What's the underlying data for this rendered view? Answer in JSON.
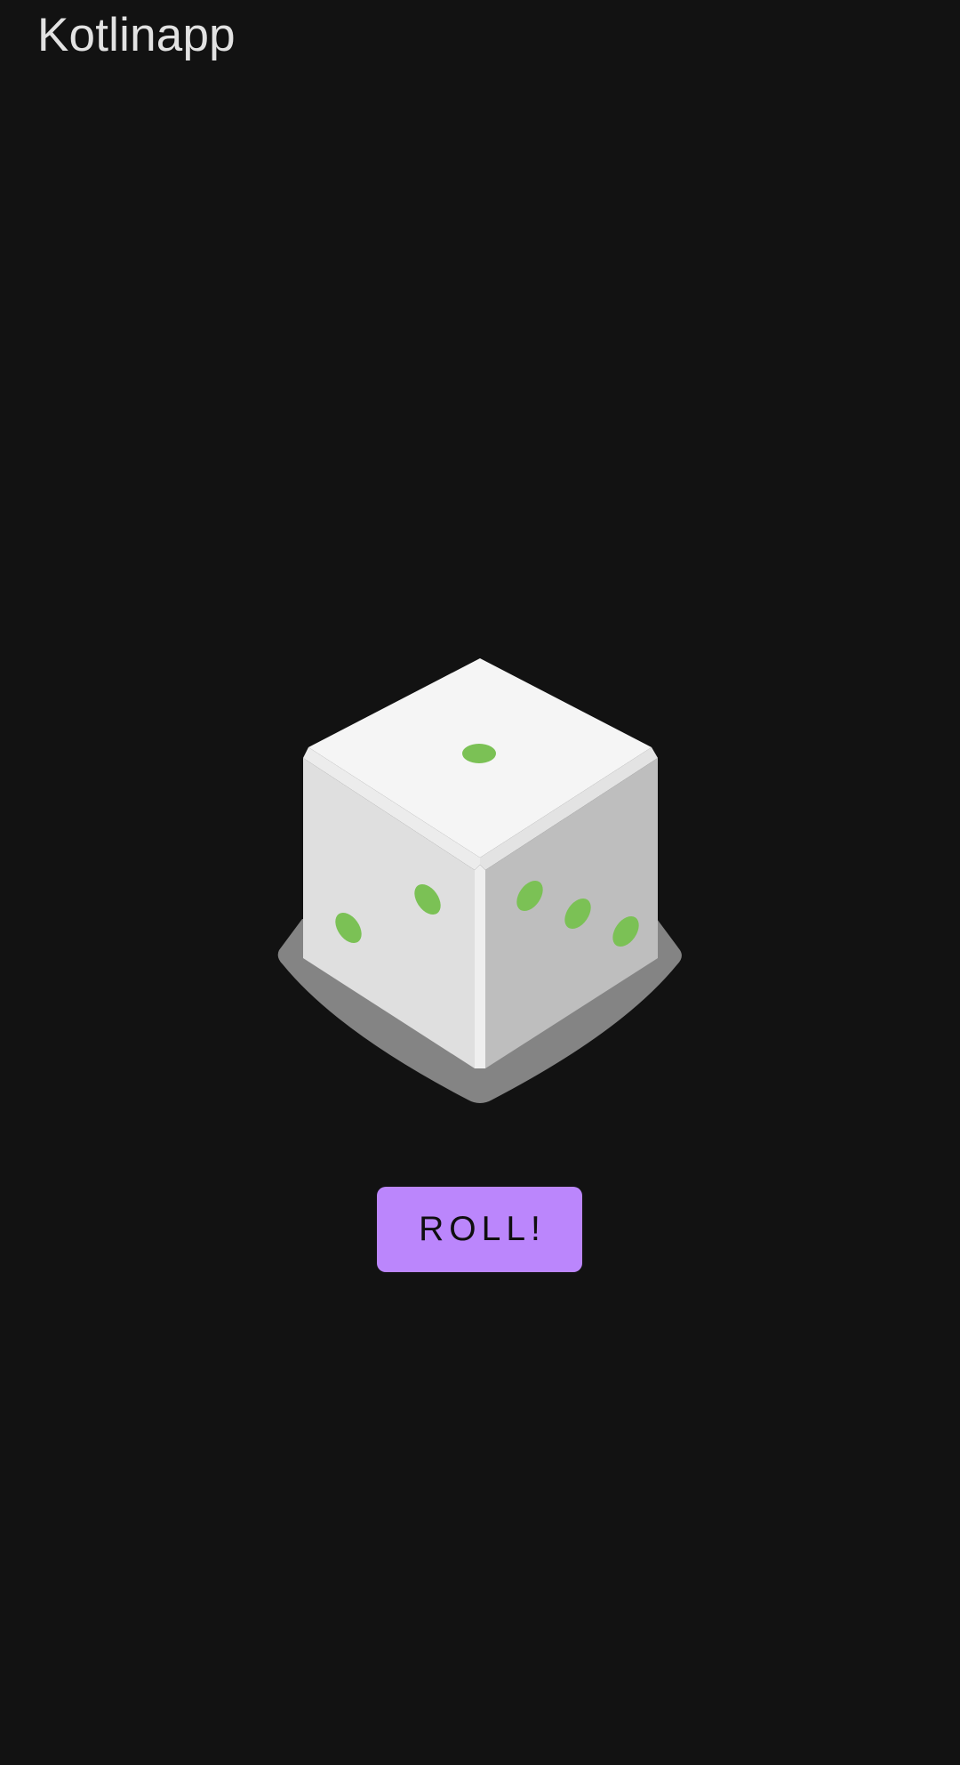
{
  "app": {
    "title": "Kotlinapp"
  },
  "dice": {
    "icon": "dice-icon",
    "top_face_pips": 1,
    "left_face_pips": 2,
    "right_face_pips": 3,
    "pip_color": "#7bc155"
  },
  "roll_button": {
    "label": "ROLL!",
    "color": "#bb86fc"
  },
  "theme": {
    "background": "#121212",
    "title_color": "#e2e2e2"
  }
}
